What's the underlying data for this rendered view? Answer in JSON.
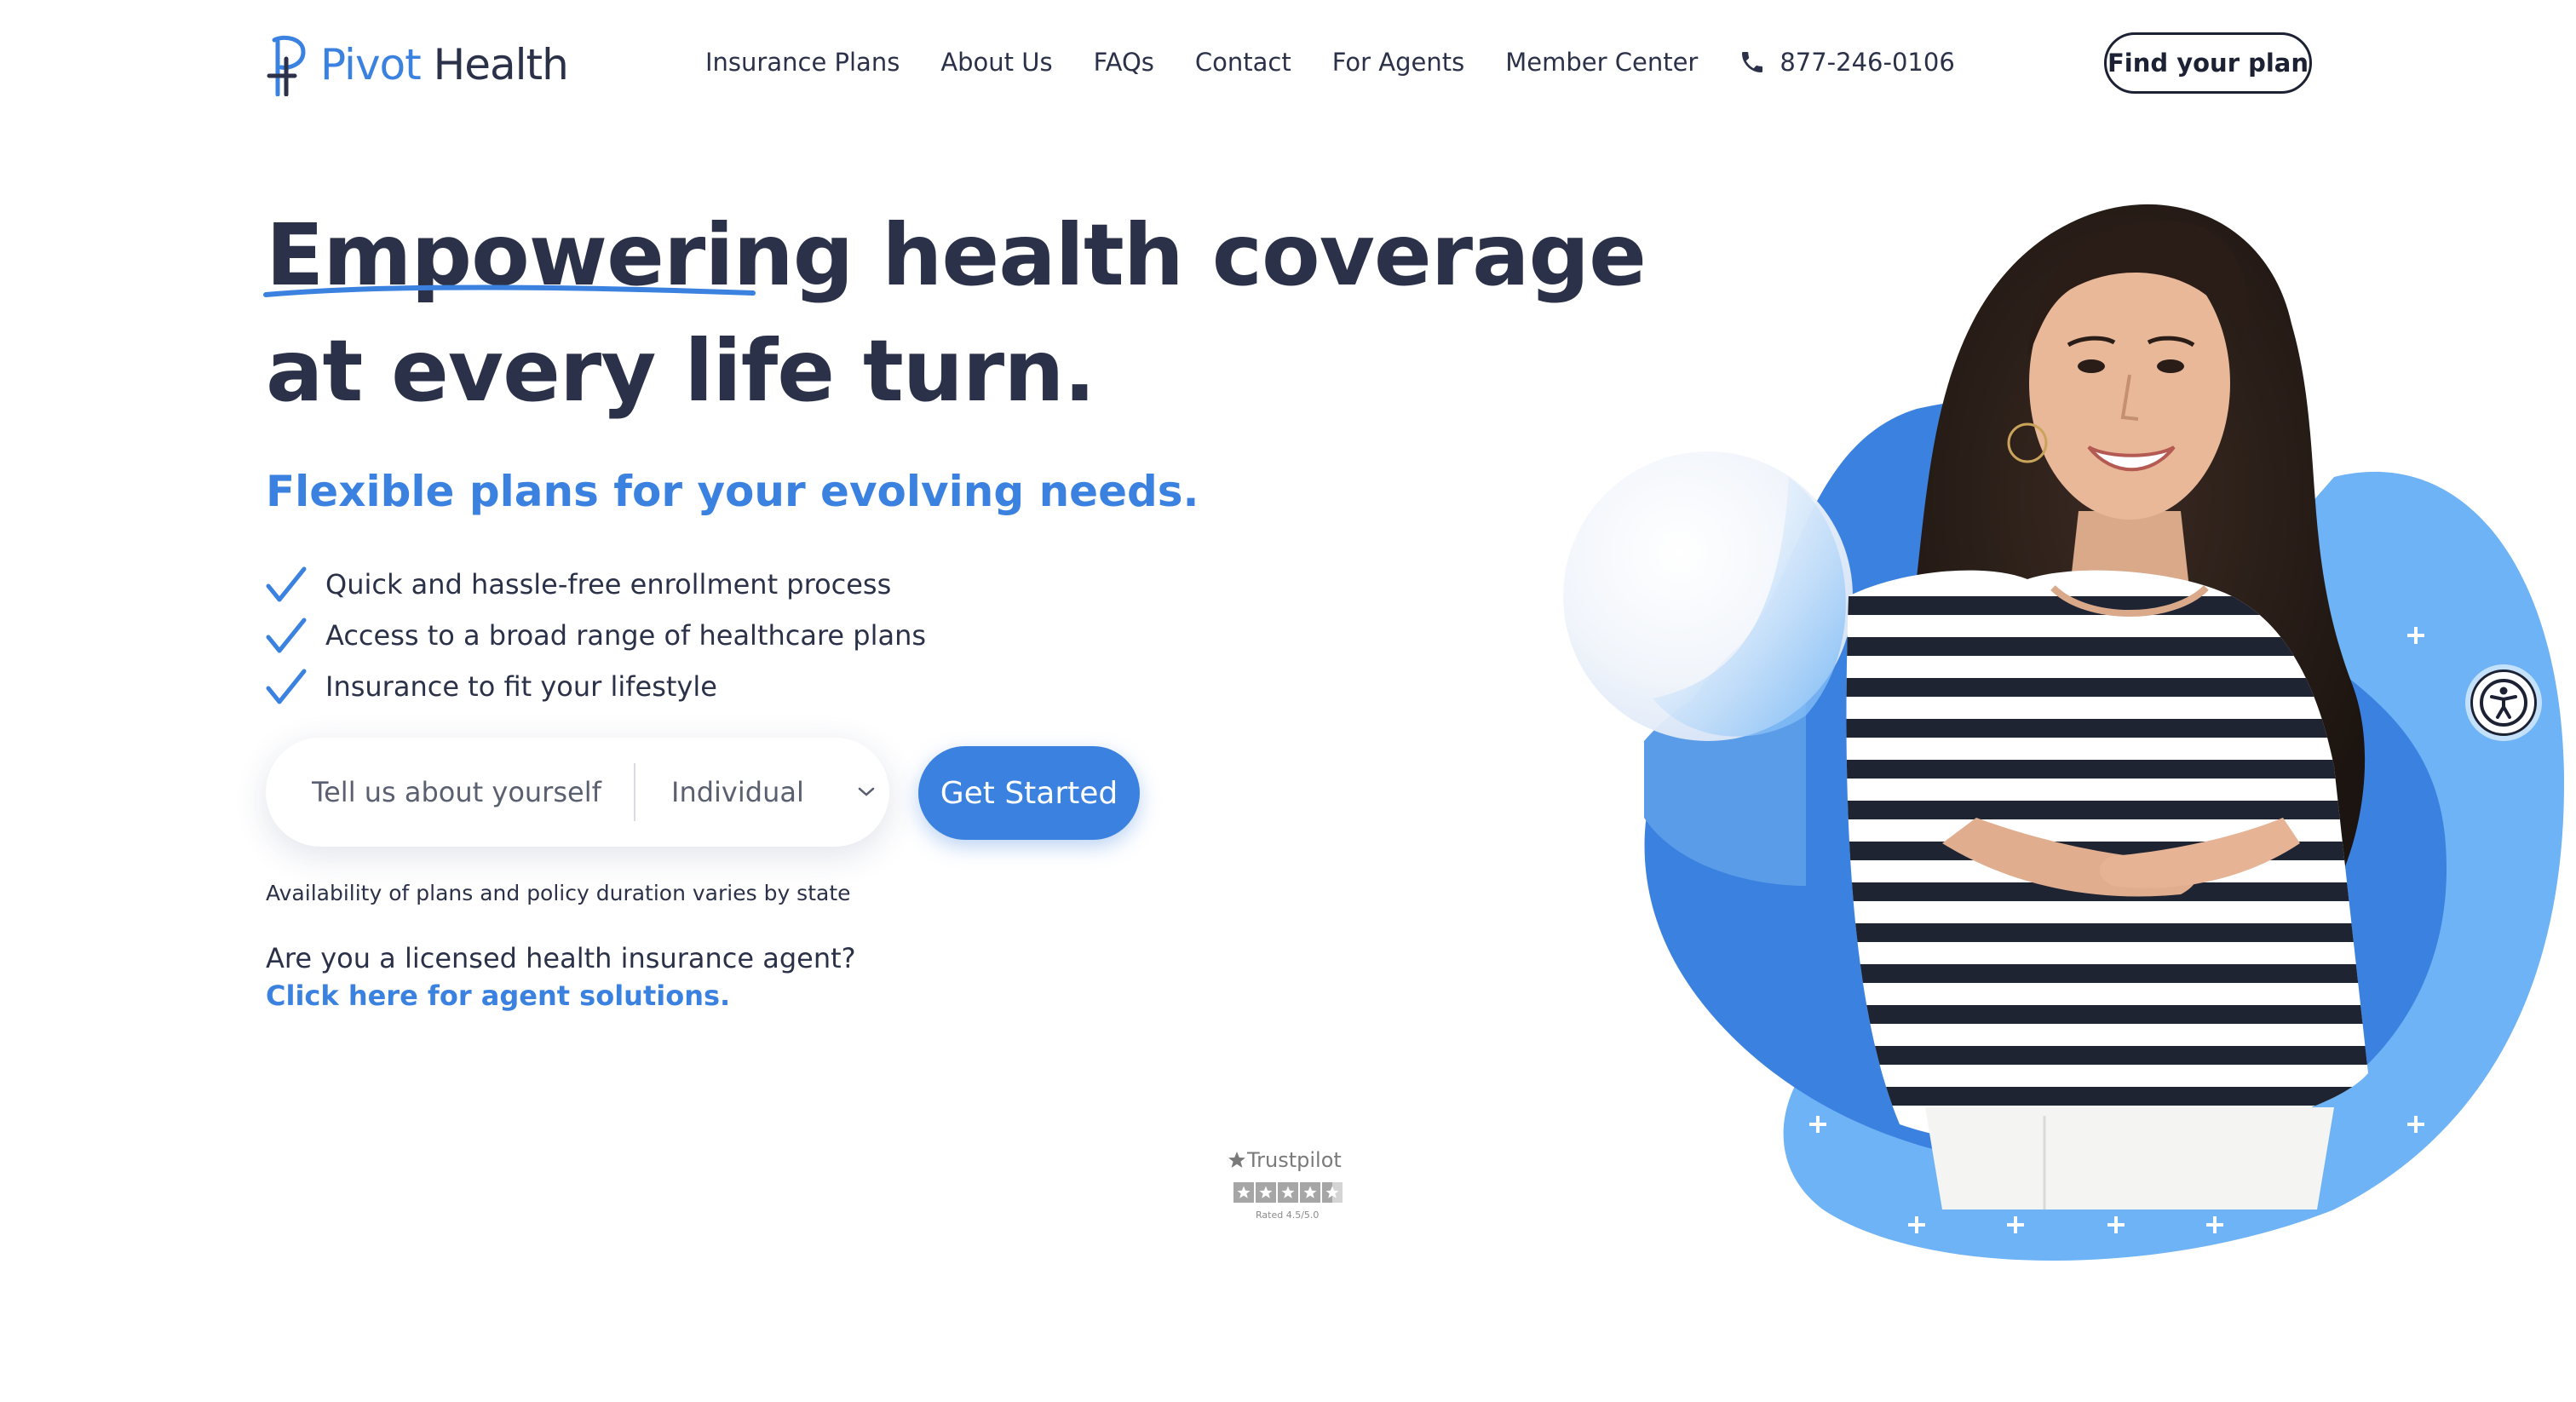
{
  "brand": {
    "name_part1": "Pivot",
    "name_part2": "Health",
    "primary_color": "#3b82e0",
    "dark_color": "#2b3148"
  },
  "nav": {
    "items": [
      {
        "label": "Insurance Plans"
      },
      {
        "label": "About Us"
      },
      {
        "label": "FAQs"
      },
      {
        "label": "Contact"
      },
      {
        "label": "For Agents"
      },
      {
        "label": "Member Center"
      }
    ],
    "phone": "877-246-0106",
    "phone_icon": "phone-icon",
    "cta_label": "Find your plan"
  },
  "hero": {
    "headline_emphasis": "Empowering",
    "headline_rest_line1": " health coverage",
    "headline_line2": "at every life turn.",
    "subheadline": "Flexible plans for your evolving needs.",
    "bullets": [
      {
        "icon": "checkmark-icon",
        "text": "Quick and hassle-free enrollment process"
      },
      {
        "icon": "checkmark-icon",
        "text": "Access to a broad range of healthcare plans"
      },
      {
        "icon": "checkmark-icon",
        "text": "Insurance to fit your lifestyle"
      }
    ],
    "form": {
      "input_placeholder": "Tell us about yourself",
      "input_value": "",
      "select_value": "Individual",
      "submit_label": "Get Started"
    },
    "availability_note": "Availability of plans and policy duration varies by state",
    "agent_question": "Are you a licensed health insurance agent?",
    "agent_link": "Click here for agent solutions."
  },
  "trustpilot": {
    "label": "Trustpilot",
    "rating_text": "Rated 4.5/5.0",
    "rating": 4.5,
    "max": 5
  },
  "accessibility": {
    "icon": "accessibility-icon"
  },
  "hero_image": {
    "subject": "smiling woman in striped shirt with arms crossed",
    "blob_colors": [
      "#3b82e0",
      "#6db3f5",
      "#2f6fd0"
    ]
  }
}
